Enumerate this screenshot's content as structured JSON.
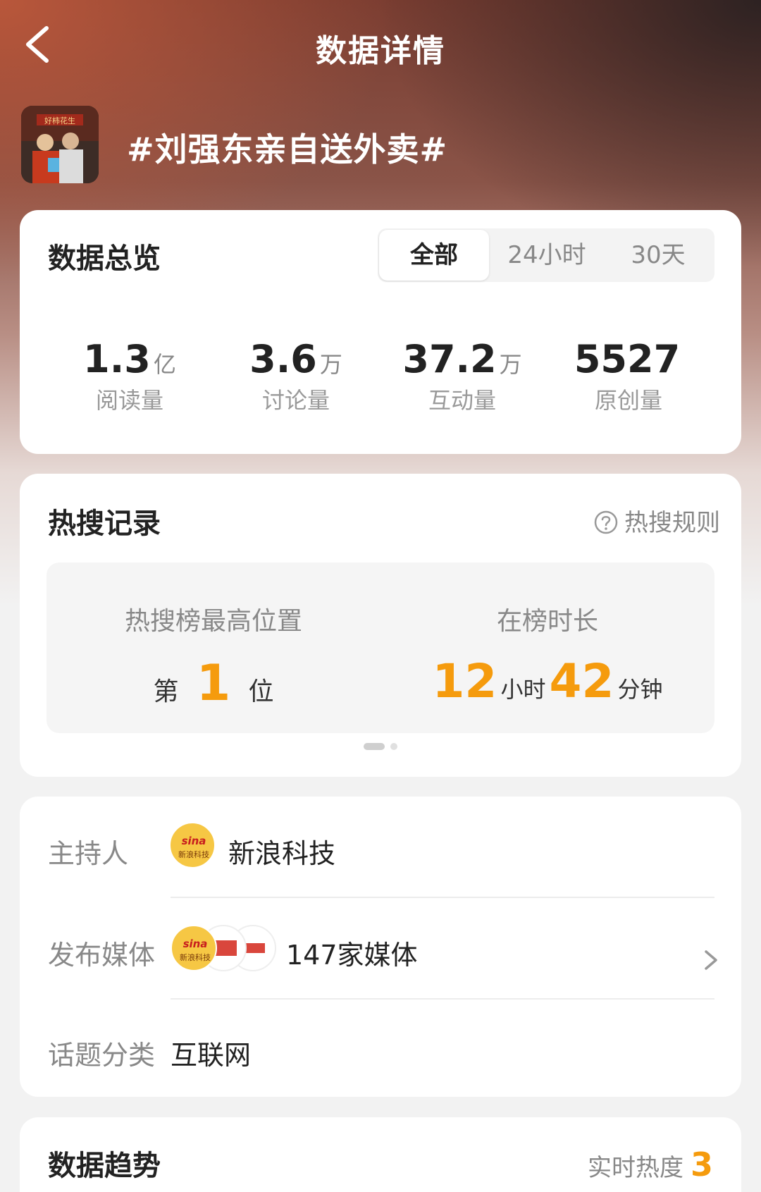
{
  "header": {
    "title": "数据详情"
  },
  "topic": {
    "title": "#刘强东亲自送外卖#",
    "thumb_sign": "好柿花生"
  },
  "overview": {
    "heading": "数据总览",
    "tabs": [
      "全部",
      "24小时",
      "30天"
    ],
    "active_tab": "全部",
    "stats": [
      {
        "value": "1.3",
        "unit": "亿",
        "label": "阅读量"
      },
      {
        "value": "3.6",
        "unit": "万",
        "label": "讨论量"
      },
      {
        "value": "37.2",
        "unit": "万",
        "label": "互动量"
      },
      {
        "value": "5527",
        "unit": "",
        "label": "原创量"
      }
    ]
  },
  "hot": {
    "heading": "热搜记录",
    "rules_link": "热搜规则",
    "peak": {
      "label": "热搜榜最高位置",
      "prefix": "第",
      "rank": "1",
      "suffix": "位"
    },
    "duration": {
      "label": "在榜时长",
      "hours": "12",
      "hours_unit": "小时",
      "minutes": "42",
      "minutes_unit": "分钟"
    }
  },
  "info": {
    "host": {
      "label": "主持人",
      "value": "新浪科技",
      "logo_text": "sina",
      "logo_sub": "新浪科技"
    },
    "media": {
      "label": "发布媒体",
      "value": "147家媒体"
    },
    "category": {
      "label": "话题分类",
      "value": "互联网"
    }
  },
  "trend": {
    "heading": "数据趋势",
    "heat_label": "实时热度",
    "heat_value": "3"
  },
  "colors": {
    "accent": "#f59b0d",
    "text_primary": "#222222",
    "text_secondary": "#888888"
  }
}
